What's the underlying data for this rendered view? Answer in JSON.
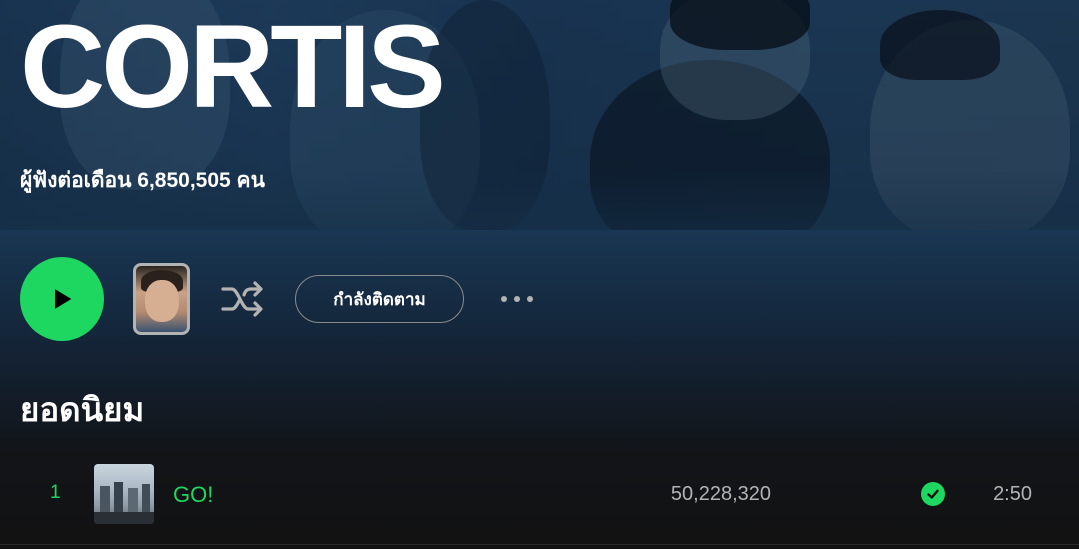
{
  "artist": {
    "name": "CORTIS",
    "monthly_listeners": "ผู้ฟังต่อเดือน 6,850,505 คน"
  },
  "actions": {
    "play_icon": "play-icon",
    "shuffle_icon": "shuffle-icon",
    "follow_label": "กำลังติดตาม",
    "more_icon": "more-options-icon"
  },
  "popular": {
    "title": "ยอดนิยม",
    "tracks": [
      {
        "index": "1",
        "title": "GO!",
        "plays": "50,228,320",
        "saved": true,
        "duration": "2:50"
      }
    ]
  },
  "colors": {
    "accent": "#1ed760",
    "background": "#121212",
    "hero": "#1c3a58",
    "secondary_text": "#b3b3b3"
  }
}
